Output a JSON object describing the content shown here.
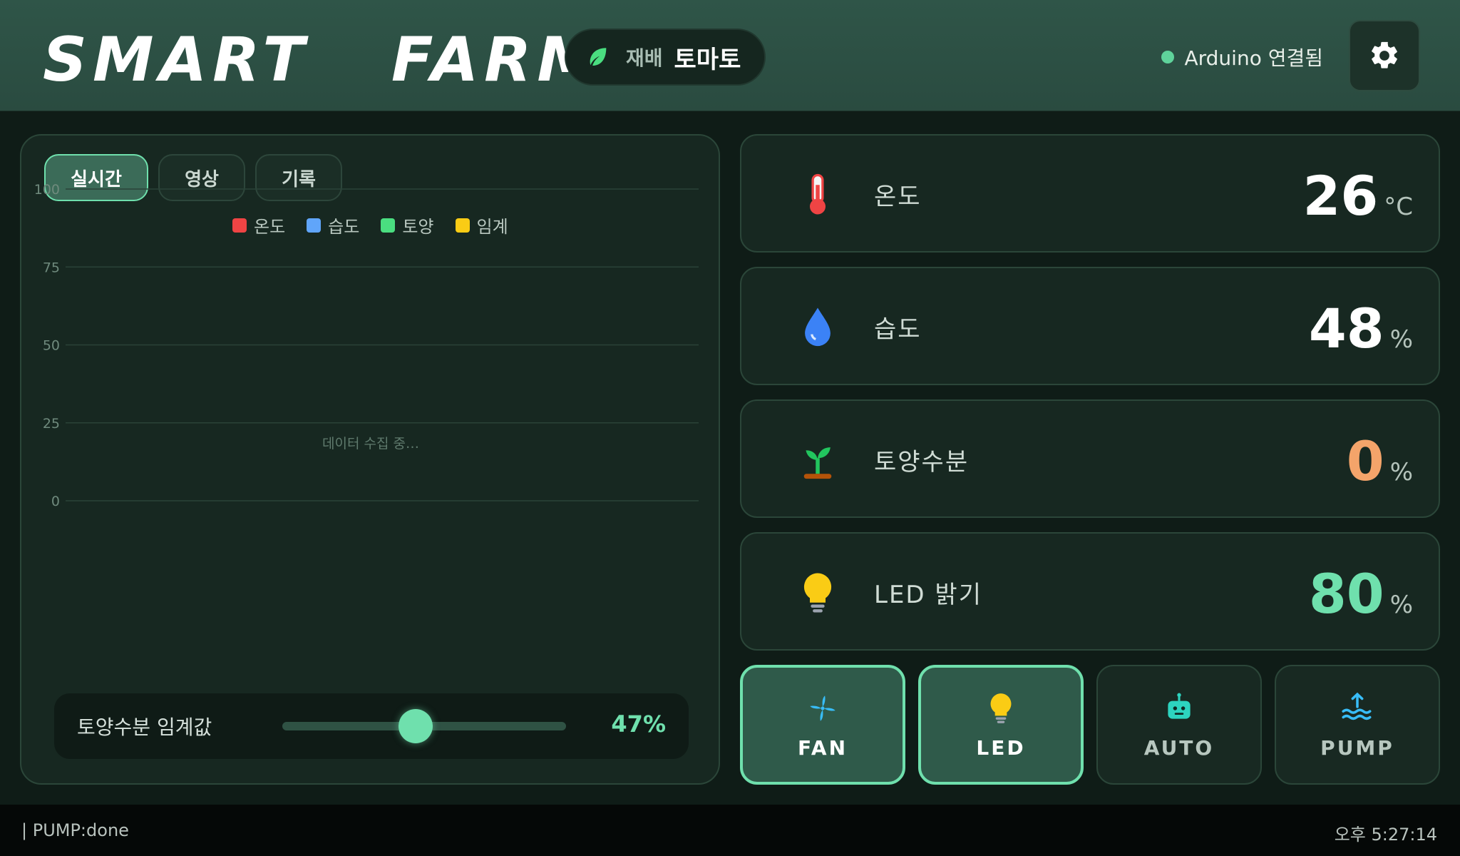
{
  "header": {
    "logo": "SMART   FARM",
    "crop_label": "재배",
    "crop_value": "토마토",
    "connection_text": "Arduino 연결됨"
  },
  "tabs": [
    {
      "label": "실시간",
      "active": true
    },
    {
      "label": "영상",
      "active": false
    },
    {
      "label": "기록",
      "active": false
    }
  ],
  "chart_data": {
    "type": "line",
    "series": [
      {
        "name": "온도",
        "color": "#ef4444",
        "values": []
      },
      {
        "name": "습도",
        "color": "#60a5fa",
        "values": []
      },
      {
        "name": "토양",
        "color": "#4ade80",
        "values": []
      },
      {
        "name": "임계",
        "color": "#facc15",
        "values": []
      }
    ],
    "y_ticks": [
      "100",
      "75",
      "50",
      "25",
      "0"
    ],
    "ylim": [
      0,
      100
    ],
    "placeholder": "데이터 수집 중…",
    "grid": true,
    "legend_position": "top-center"
  },
  "threshold": {
    "label": "토양수분 임계값",
    "value_text": "47%",
    "value": 47
  },
  "sensors": [
    {
      "name": "온도",
      "value": "26",
      "unit": "°C",
      "color": "#ffffff",
      "icon": "thermometer-icon"
    },
    {
      "name": "습도",
      "value": "48",
      "unit": "%",
      "color": "#ffffff",
      "icon": "water-drop-icon"
    },
    {
      "name": "토양수분",
      "value": "0",
      "unit": "%",
      "color": "#f4a46a",
      "icon": "sprout-icon"
    },
    {
      "name": "LED 밝기",
      "value": "80",
      "unit": "%",
      "color": "#6fe0ad",
      "icon": "lightbulb-icon"
    }
  ],
  "controls": [
    {
      "label": "FAN",
      "on": true,
      "icon": "fan-icon"
    },
    {
      "label": "LED",
      "on": true,
      "icon": "lightbulb-icon"
    },
    {
      "label": "AUTO",
      "on": false,
      "icon": "robot-icon"
    },
    {
      "label": "PUMP",
      "on": false,
      "icon": "pump-water-icon"
    }
  ],
  "status": {
    "log": "| PUMP:done",
    "time": "오후 5:27:14"
  },
  "colors": {
    "accent": "#6fe0ad",
    "background": "#0f1c17",
    "header": "#2f5548"
  }
}
